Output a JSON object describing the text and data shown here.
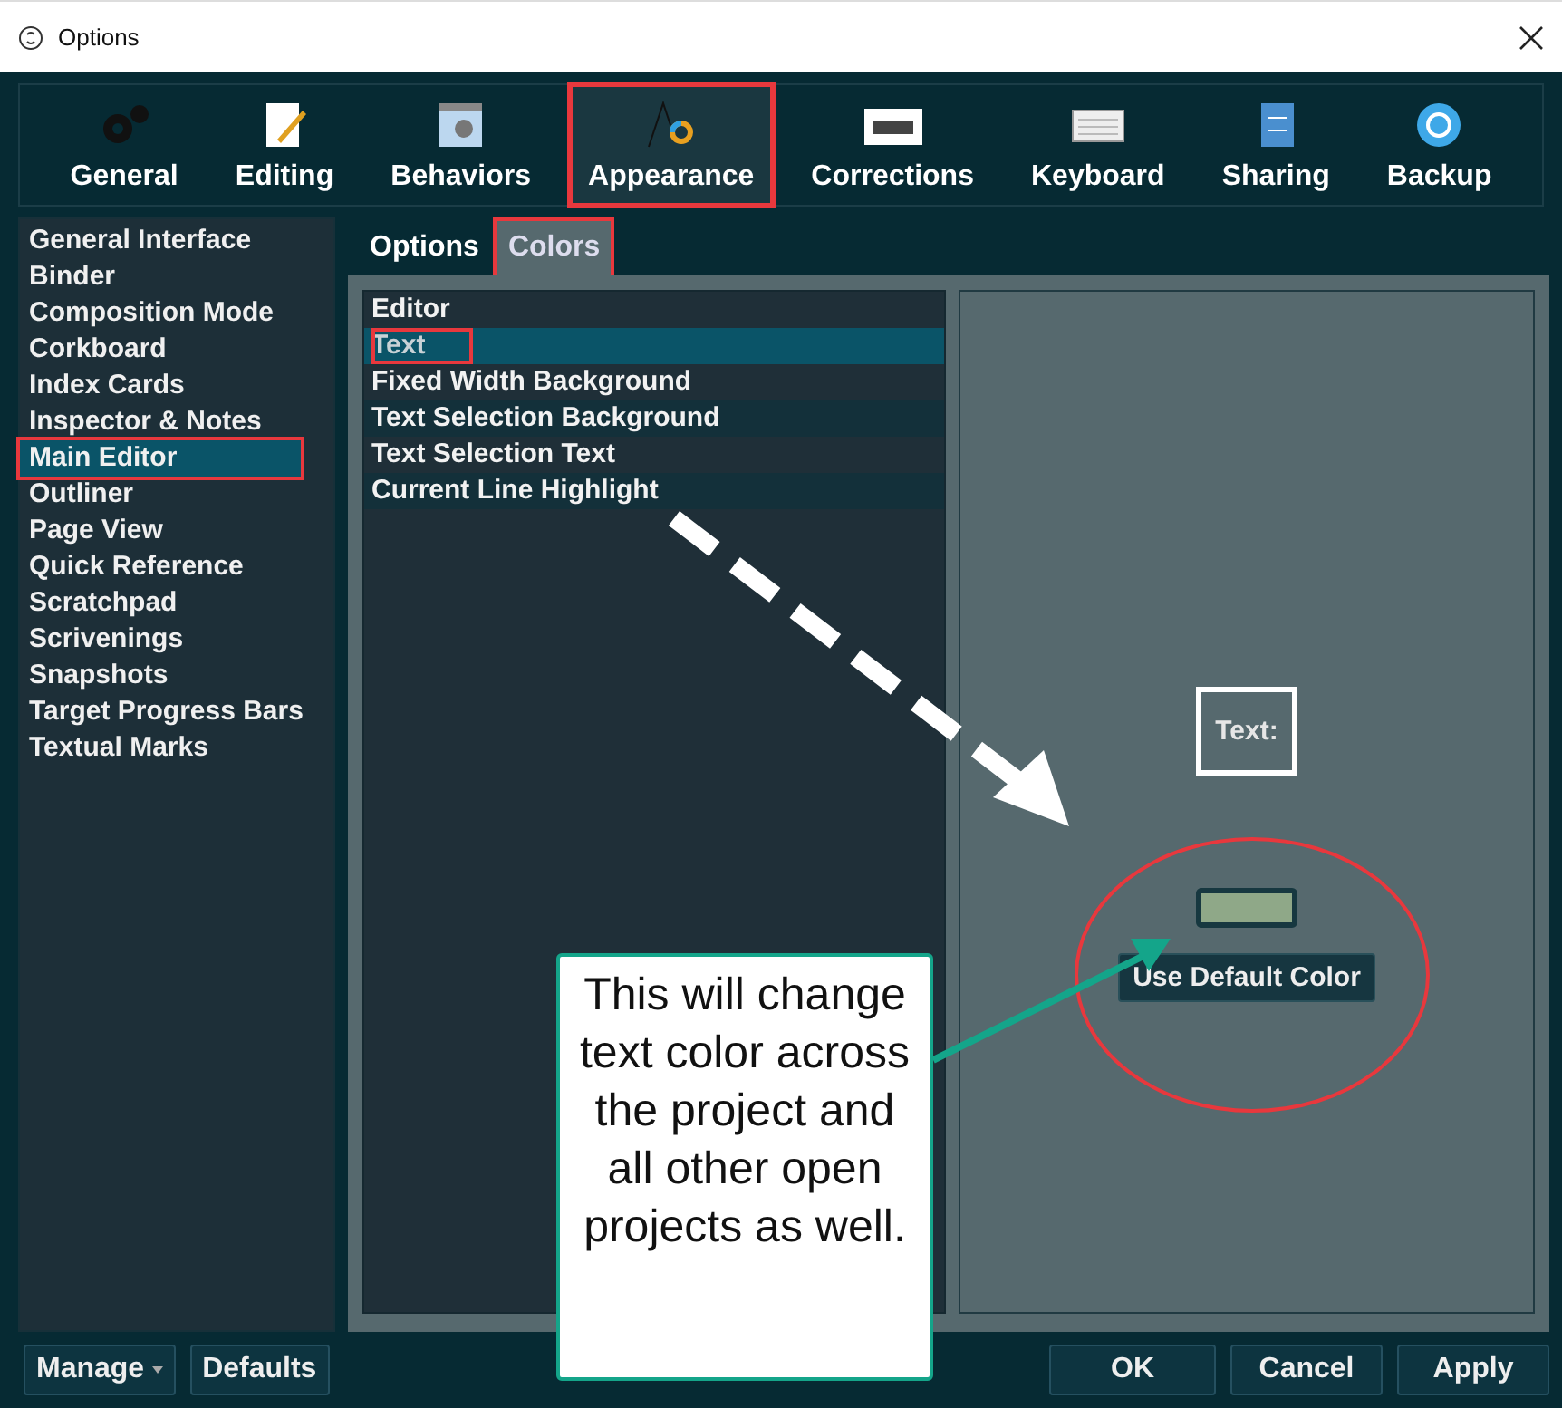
{
  "window": {
    "title": "Options"
  },
  "toolbar": [
    {
      "label": "General",
      "selected": false,
      "highlighted": false
    },
    {
      "label": "Editing",
      "selected": false,
      "highlighted": false
    },
    {
      "label": "Behaviors",
      "selected": false,
      "highlighted": false
    },
    {
      "label": "Appearance",
      "selected": true,
      "highlighted": true
    },
    {
      "label": "Corrections",
      "selected": false,
      "highlighted": false
    },
    {
      "label": "Keyboard",
      "selected": false,
      "highlighted": false
    },
    {
      "label": "Sharing",
      "selected": false,
      "highlighted": false
    },
    {
      "label": "Backup",
      "selected": false,
      "highlighted": false
    }
  ],
  "categories": [
    {
      "label": "General Interface",
      "selected": false,
      "highlighted": false
    },
    {
      "label": "Binder",
      "selected": false,
      "highlighted": false
    },
    {
      "label": "Composition Mode",
      "selected": false,
      "highlighted": false
    },
    {
      "label": "Corkboard",
      "selected": false,
      "highlighted": false
    },
    {
      "label": "Index Cards",
      "selected": false,
      "highlighted": false
    },
    {
      "label": "Inspector & Notes",
      "selected": false,
      "highlighted": false
    },
    {
      "label": "Main Editor",
      "selected": true,
      "highlighted": true
    },
    {
      "label": "Outliner",
      "selected": false,
      "highlighted": false
    },
    {
      "label": "Page View",
      "selected": false,
      "highlighted": false
    },
    {
      "label": "Quick Reference",
      "selected": false,
      "highlighted": false
    },
    {
      "label": "Scratchpad",
      "selected": false,
      "highlighted": false
    },
    {
      "label": "Scrivenings",
      "selected": false,
      "highlighted": false
    },
    {
      "label": "Snapshots",
      "selected": false,
      "highlighted": false
    },
    {
      "label": "Target Progress Bars",
      "selected": false,
      "highlighted": false
    },
    {
      "label": "Textual Marks",
      "selected": false,
      "highlighted": false
    }
  ],
  "tabs": [
    {
      "label": "Options",
      "selected": false,
      "highlighted": false
    },
    {
      "label": "Colors",
      "selected": true,
      "highlighted": true
    }
  ],
  "color_list": [
    {
      "label": "Editor",
      "selected": false,
      "highlighted": false
    },
    {
      "label": "Text",
      "selected": true,
      "highlighted": true
    },
    {
      "label": "Fixed Width Background",
      "selected": false,
      "highlighted": false
    },
    {
      "label": "Text Selection Background",
      "selected": false,
      "highlighted": false
    },
    {
      "label": "Text Selection Text",
      "selected": false,
      "highlighted": false
    },
    {
      "label": "Current Line Highlight",
      "selected": false,
      "highlighted": false
    }
  ],
  "preview": {
    "label": "Text:",
    "color": "#8fa888",
    "button": "Use Default Color"
  },
  "callout": "This will change text color across the project and all other open projects as well.",
  "footer": {
    "left": [
      "Manage",
      "Defaults"
    ],
    "right": [
      "OK",
      "Cancel",
      "Apply"
    ]
  }
}
